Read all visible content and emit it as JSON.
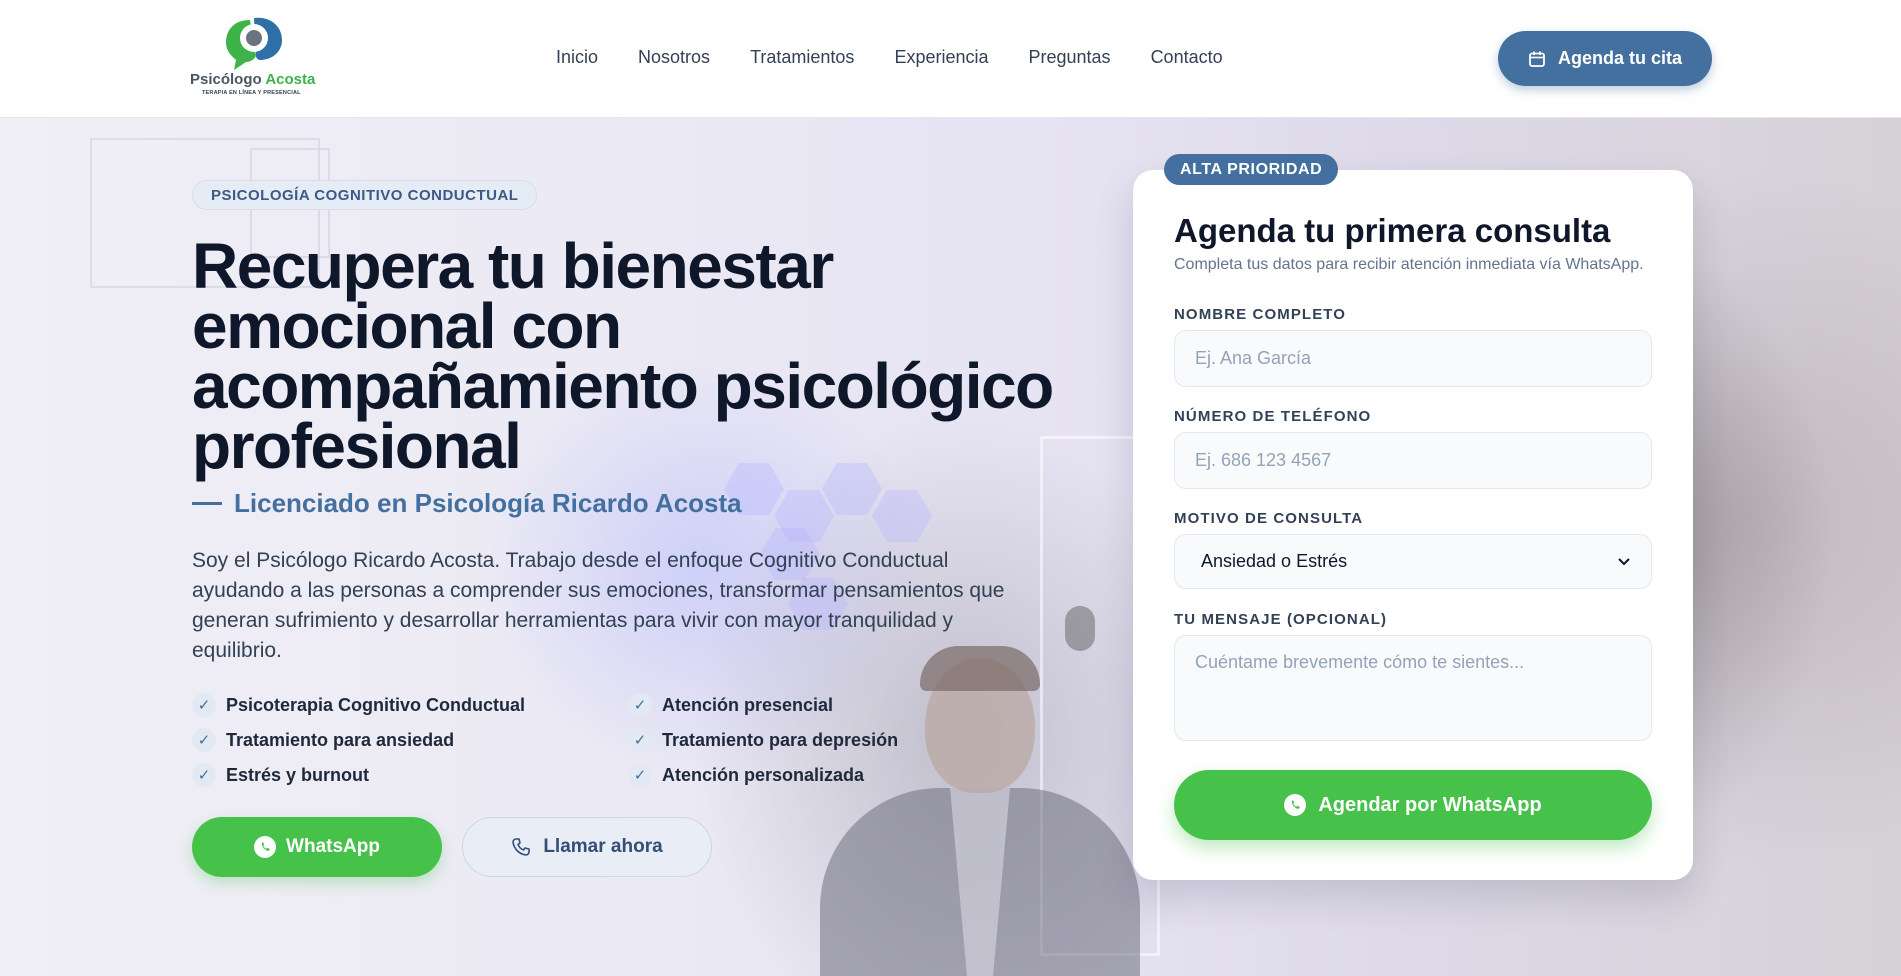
{
  "brand": {
    "name_main": "Psicólogo",
    "name_accent": "Acosta",
    "tagline": "TERAPIA EN LÍNEA Y PRESENCIAL"
  },
  "nav": {
    "items": [
      "Inicio",
      "Nosotros",
      "Tratamientos",
      "Experiencia",
      "Preguntas",
      "Contacto"
    ],
    "cta_label": "Agenda tu cita"
  },
  "hero": {
    "badge": "PSICOLOGÍA COGNITIVO CONDUCTUAL",
    "title": "Recupera tu bienestar emocional con acompañamiento psicológico profesional",
    "subtitle": "Licenciado en Psicología Ricardo Acosta",
    "description": "Soy el Psicólogo Ricardo Acosta. Trabajo desde el enfoque Cognitivo Conductual ayudando a las personas a comprender sus emociones, transformar pensamientos que generan sufrimiento y desarrollar herramientas para vivir con mayor tranquilidad y equilibrio.",
    "features": [
      "Psicoterapia Cognitivo Conductual",
      "Atención presencial",
      "Tratamiento para ansiedad",
      "Tratamiento para depresión",
      "Estrés y burnout",
      "Atención personalizada"
    ],
    "whatsapp_label": "WhatsApp",
    "call_label": "Llamar ahora"
  },
  "form": {
    "priority_badge": "ALTA PRIORIDAD",
    "title": "Agenda tu primera consulta",
    "subtitle": "Completa tus datos para recibir atención inmediata vía WhatsApp.",
    "name_label": "NOMBRE COMPLETO",
    "name_placeholder": "Ej. Ana García",
    "phone_label": "NÚMERO DE TELÉFONO",
    "phone_placeholder": "Ej. 686 123 4567",
    "reason_label": "MOTIVO DE CONSULTA",
    "reason_value": "Ansiedad o Estrés",
    "message_label": "TU MENSAJE (OPCIONAL)",
    "message_placeholder": "Cuéntame brevemente cómo te sientes...",
    "submit_label": "Agendar por WhatsApp"
  },
  "colors": {
    "primary": "#43709f",
    "whatsapp": "#46c24b",
    "logo_green": "#3db34a",
    "logo_blue": "#2f6fa8",
    "text_dark": "#0f172a"
  },
  "icons": {
    "cta_top": "calendar-icon",
    "whatsapp": "whatsapp-icon",
    "call": "phone-icon",
    "check": "check-icon",
    "select": "chevron-down-icon"
  }
}
